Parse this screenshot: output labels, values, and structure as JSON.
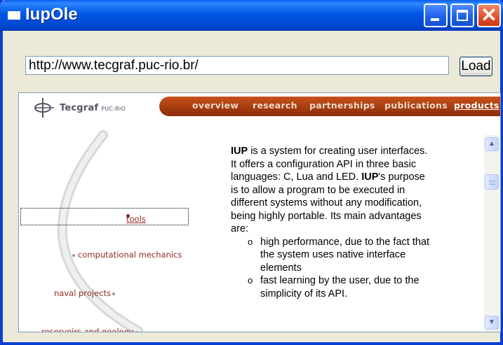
{
  "window": {
    "title": "IupOle"
  },
  "titlebar_buttons": {
    "minimize_icon": "minimize-icon",
    "maximize_icon": "maximize-icon",
    "close_icon": "close-icon",
    "close_glyph": "✕"
  },
  "address": {
    "value": "http://www.tecgraf.puc-rio.br/",
    "load_label": "Load"
  },
  "page": {
    "logo": {
      "name": "Tecgraf",
      "sub": "PUC-RIO"
    },
    "nav": [
      {
        "label": "overview"
      },
      {
        "label": "research"
      },
      {
        "label": "partnerships"
      },
      {
        "label": "publications"
      },
      {
        "label": "products",
        "active": true
      }
    ],
    "menu": [
      {
        "label": "tools"
      },
      {
        "label": "computational mechanics"
      },
      {
        "label": "naval projects"
      },
      {
        "label": "reservoirs and geology"
      }
    ],
    "content": {
      "intro_bold1": "IUP",
      "intro_text1": " is a system for creating user interfaces. It offers a configuration API in three basic languages: C, Lua and LED. ",
      "intro_bold2": "IUP",
      "intro_text2": "'s purpose is to allow a program to be executed in different systems without any modification, being highly portable. Its main advantages are:",
      "advantages": [
        "high performance, due to the fact that the system uses native interface elements",
        "fast learning by the user, due to the simplicity of its API."
      ]
    }
  },
  "scrollbar": {
    "up_glyph": "▲",
    "down_glyph": "▼"
  }
}
